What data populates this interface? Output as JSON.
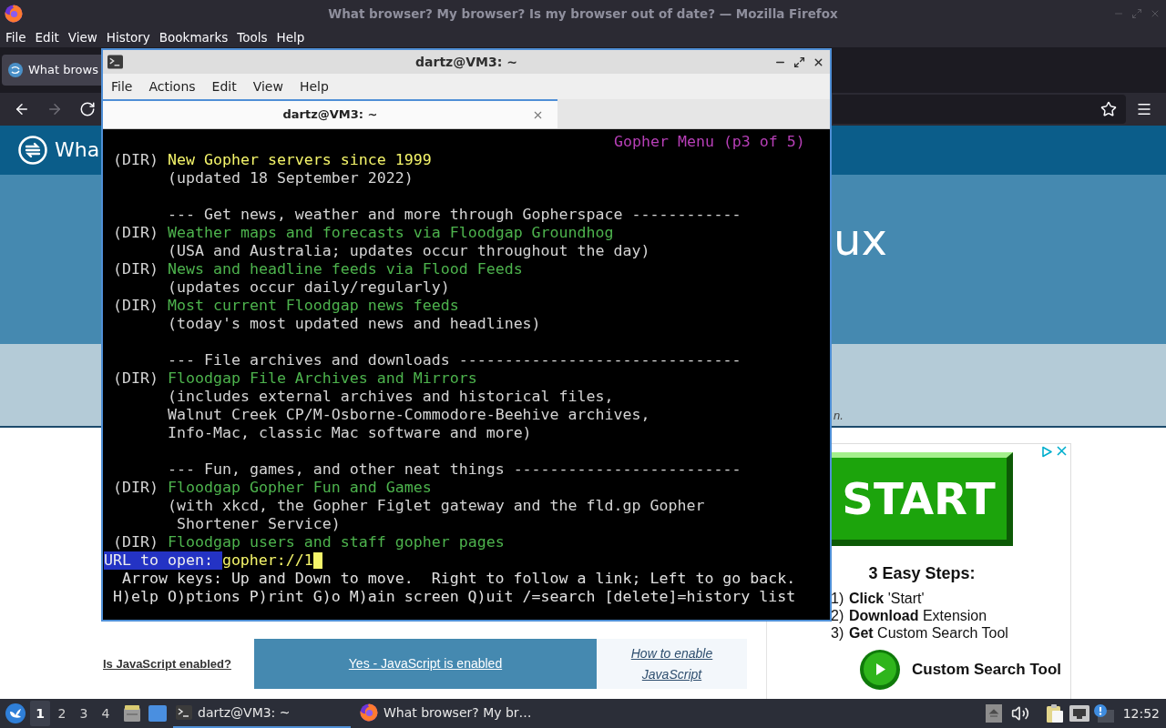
{
  "firefox": {
    "title": "What browser? My browser? Is my browser out of date? — Mozilla Firefox",
    "menu": [
      "File",
      "Edit",
      "View",
      "History",
      "Bookmarks",
      "Tools",
      "Help"
    ],
    "tabs": [
      {
        "label": "What brows",
        "selected": true
      }
    ],
    "nav_buttons": [
      {
        "kind": "back",
        "disabled": false
      },
      {
        "kind": "forward",
        "disabled": true
      },
      {
        "kind": "reload",
        "disabled": false
      }
    ]
  },
  "page": {
    "site_title": "Wha",
    "heading": "ux",
    "subtitle": "n.",
    "js_check": {
      "question": "Is JavaScript enabled?",
      "result": "Yes - JavaScript is enabled",
      "help_link": "How to enable JavaScript"
    },
    "ad": {
      "button": "START",
      "heading": "3 Easy Steps:",
      "steps": [
        {
          "number": "1)",
          "text": "**Click** 'Start'"
        },
        {
          "number": "2)",
          "text": "**Download** Extension"
        },
        {
          "number": "3)",
          "text": "**Get** Custom Search Tool"
        }
      ],
      "cta": "Custom Search Tool"
    }
  },
  "terminal": {
    "title": "dartz@VM3: ~",
    "menu": [
      "File",
      "Actions",
      "Edit",
      "View",
      "Help"
    ],
    "tabs": [
      {
        "label": "dartz@VM3: ~",
        "selected": true
      }
    ],
    "page_label": "Gopher Menu (p3 of 5)",
    "lines": [
      {
        "kind": "link",
        "tag": "(DIR)",
        "link": "New Gopher servers since 1999",
        "selected": true
      },
      {
        "kind": "note",
        "text": "(updated 18 September 2022)"
      },
      {
        "kind": "heading",
        "text": "--- Get news, weather and more through Gopherspace ------------"
      },
      {
        "kind": "link",
        "tag": "(DIR)",
        "link": "Weather maps and forecasts via Floodgap Groundhog",
        "selected": false
      },
      {
        "kind": "note",
        "text": "(USA and Australia; updates occur throughout the day)"
      },
      {
        "kind": "link",
        "tag": "(DIR)",
        "link": "News and headline feeds via Flood Feeds",
        "selected": false
      },
      {
        "kind": "note",
        "text": "(updates occur daily/regularly)"
      },
      {
        "kind": "link",
        "tag": "(DIR)",
        "link": "Most current Floodgap news feeds",
        "selected": false
      },
      {
        "kind": "note",
        "text": "(today's most updated news and headlines)"
      },
      {
        "kind": "heading",
        "text": "--- File archives and downloads -------------------------------"
      },
      {
        "kind": "link",
        "tag": "(DIR)",
        "link": "Floodgap File Archives and Mirrors",
        "selected": false
      },
      {
        "kind": "note",
        "text": "(includes external archives and historical files,"
      },
      {
        "kind": "note",
        "text": "Walnut Creek CP/M-Osborne-Commodore-Beehive archives,"
      },
      {
        "kind": "note",
        "text": "Info-Mac, classic Mac software and more)"
      },
      {
        "kind": "heading",
        "text": "--- Fun, games, and other neat things -------------------------"
      },
      {
        "kind": "link",
        "tag": "(DIR)",
        "link": "Floodgap Gopher Fun and Games",
        "selected": false
      },
      {
        "kind": "note",
        "text": "(with xkcd, the Gopher Figlet gateway and the fld.gp Gopher"
      },
      {
        "kind": "wrap",
        "text": "Shortener Service)"
      },
      {
        "kind": "link",
        "tag": "(DIR)",
        "link": "Floodgap users and staff gopher pages",
        "selected": false
      }
    ],
    "prompt": {
      "label": "URL to open:",
      "value": "gopher://1"
    },
    "help_lines": [
      "Arrow keys: Up and Down to move.  Right to follow a link; Left to go back.",
      "H)elp O)ptions P)rint G)o M)ain screen Q)uit /=search [delete]=history list"
    ]
  },
  "taskbar": {
    "workspaces": [
      {
        "label": "1",
        "selected": true
      },
      {
        "label": "2",
        "selected": false
      },
      {
        "label": "3",
        "selected": false
      },
      {
        "label": "4",
        "selected": false
      }
    ],
    "tasks": [
      {
        "kind": "terminal",
        "label": "dartz@VM3: ~",
        "selected": true
      },
      {
        "kind": "browser",
        "label": "What browser? My br…",
        "selected": false
      }
    ],
    "clock": "12:52"
  }
}
